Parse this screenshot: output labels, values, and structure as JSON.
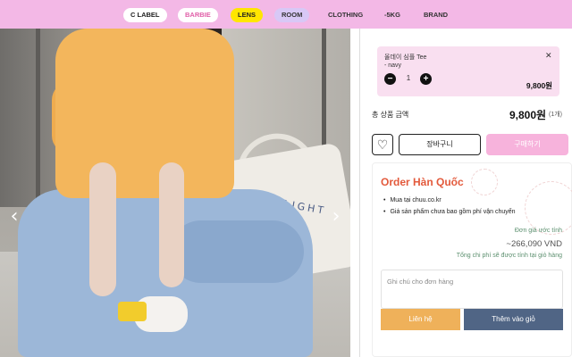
{
  "nav": {
    "items": [
      {
        "label": "C LABEL"
      },
      {
        "label": "BARBIE"
      },
      {
        "label": "LENS"
      },
      {
        "label": "ROOM"
      },
      {
        "label": "CLOTHING"
      },
      {
        "label": "-5KG"
      },
      {
        "label": "BRAND"
      }
    ]
  },
  "photo": {
    "bag_text": "DELIGHT",
    "prev_arrow": "‹",
    "next_arrow": "›"
  },
  "cart_item": {
    "name": "올데이 심플 Tee",
    "option": "- navy",
    "quantity": "1",
    "price": "9,800원",
    "minus": "−",
    "plus": "+",
    "close": "✕"
  },
  "totals": {
    "label": "총 상품 금액",
    "value": "9,800원",
    "unit": "(1개)"
  },
  "actions": {
    "wishlist_icon": "♡",
    "cart_label": "장바구니",
    "buy_label": "구매하기"
  },
  "order": {
    "title": "Order Hàn Quốc",
    "bullets": [
      "Mua tại chuu.co.kr",
      "Giá sản phẩm chưa bao gồm phí vận chuyển"
    ],
    "estimate_label": "Đơn giá ước tính",
    "estimate_value": "~266,090 VND",
    "estimate_note": "Tổng chi phí sẽ được tính tại giỏ hàng",
    "note_placeholder": "Ghi chú cho đơn hàng",
    "contact_label": "Liên hệ",
    "add_to_cart_label": "Thêm vào giỏ"
  },
  "colors": {
    "nav_bg": "#f3b8e6",
    "buy_pink": "#f7b3dc",
    "order_title": "#e35a3c",
    "contact_orange": "#efb15a",
    "add_cart_navy": "#506585"
  }
}
